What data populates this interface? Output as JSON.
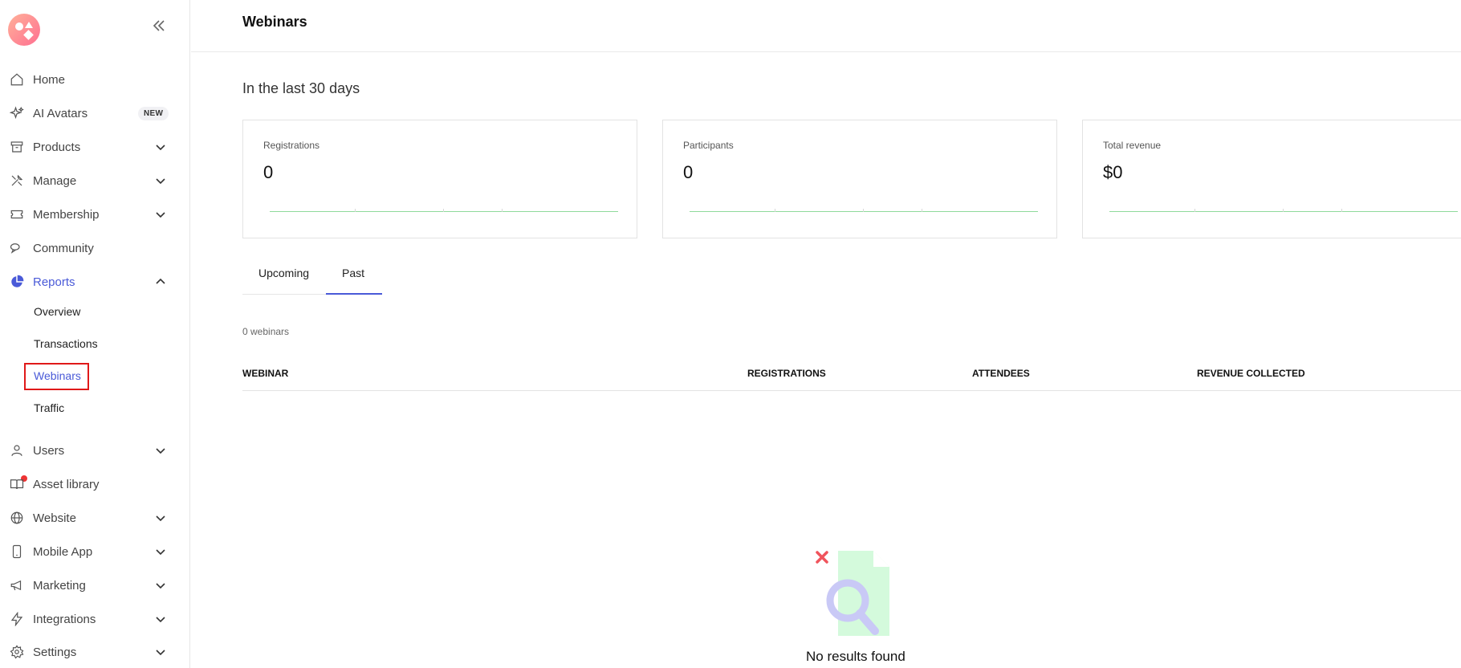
{
  "sidebar": {
    "items": [
      {
        "label": "Home"
      },
      {
        "label": "AI Avatars",
        "badge": "NEW"
      },
      {
        "label": "Products"
      },
      {
        "label": "Manage"
      },
      {
        "label": "Membership"
      },
      {
        "label": "Community"
      },
      {
        "label": "Reports"
      },
      {
        "label": "Users"
      },
      {
        "label": "Asset library"
      },
      {
        "label": "Website"
      },
      {
        "label": "Mobile App"
      },
      {
        "label": "Marketing"
      },
      {
        "label": "Integrations"
      },
      {
        "label": "Settings"
      }
    ],
    "reports_sub": [
      "Overview",
      "Transactions",
      "Webinars",
      "Traffic"
    ]
  },
  "header": {
    "title": "Webinars"
  },
  "main": {
    "section_title": "In the last 30 days",
    "cards": [
      {
        "label": "Registrations",
        "value": "0"
      },
      {
        "label": "Participants",
        "value": "0"
      },
      {
        "label": "Total revenue",
        "value": "$0"
      }
    ],
    "tabs": [
      {
        "label": "Upcoming"
      },
      {
        "label": "Past"
      }
    ],
    "webinar_count": "0 webinars",
    "table": {
      "columns": [
        "WEBINAR",
        "REGISTRATIONS",
        "ATTENDEES",
        "REVENUE COLLECTED"
      ]
    },
    "empty_state": "No results found"
  },
  "colors": {
    "accent": "#4a5ad8",
    "highlight": "#e01919",
    "sparkline": "#8fd99b"
  }
}
